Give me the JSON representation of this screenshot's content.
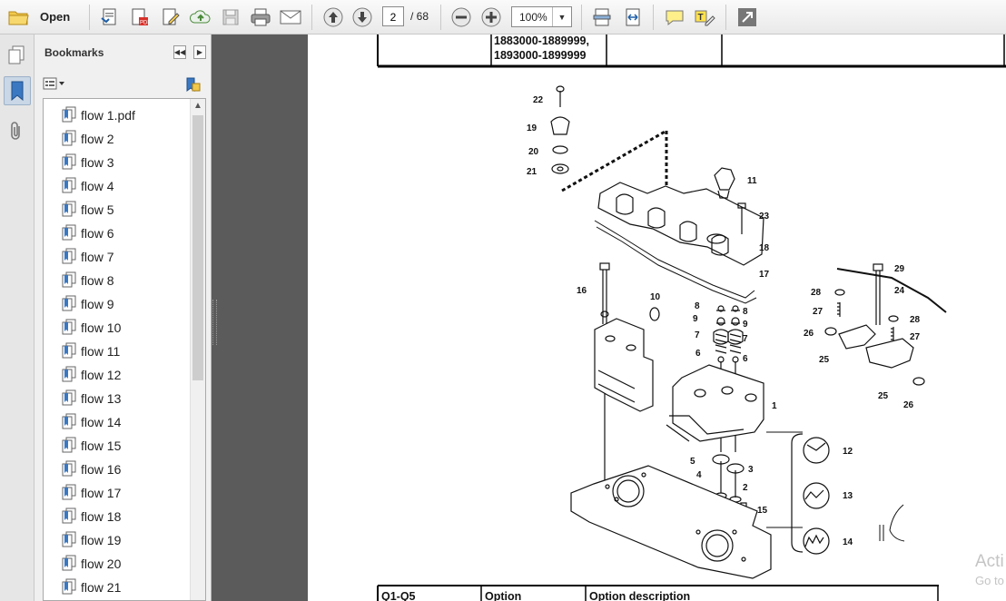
{
  "toolbar": {
    "open_label": "Open",
    "current_page": "2",
    "total_pages": "/ 68",
    "zoom_value": "100%"
  },
  "bookmarks": {
    "title": "Bookmarks",
    "items": [
      {
        "label": "flow 1.pdf"
      },
      {
        "label": "flow 2"
      },
      {
        "label": "flow 3"
      },
      {
        "label": "flow 4"
      },
      {
        "label": "flow 5"
      },
      {
        "label": "flow 6"
      },
      {
        "label": "flow 7"
      },
      {
        "label": "flow 8"
      },
      {
        "label": "flow 9"
      },
      {
        "label": "flow 10"
      },
      {
        "label": "flow 11"
      },
      {
        "label": "flow 12"
      },
      {
        "label": "flow 13"
      },
      {
        "label": "flow 14"
      },
      {
        "label": "flow 15"
      },
      {
        "label": "flow 16"
      },
      {
        "label": "flow 17"
      },
      {
        "label": "flow 18"
      },
      {
        "label": "flow 19"
      },
      {
        "label": "flow 20"
      },
      {
        "label": "flow 21"
      }
    ]
  },
  "document": {
    "table_top": {
      "serial_1": "1883000-1889999,",
      "serial_2": "1893000-1899999"
    },
    "diagram_labels": {
      "l1": "1",
      "l2": "2",
      "l3": "3",
      "l4": "4",
      "l5": "5",
      "l6a": "6",
      "l6b": "6",
      "l7a": "7",
      "l7b": "7",
      "l8a": "8",
      "l8b": "8",
      "l9a": "9",
      "l9b": "9",
      "l10": "10",
      "l11": "11",
      "l12": "12",
      "l13": "13",
      "l14": "14",
      "l15": "15",
      "l16": "16",
      "l17": "17",
      "l18": "18",
      "l19": "19",
      "l20": "20",
      "l21": "21",
      "l22": "22",
      "l23": "23",
      "l24": "24",
      "l25a": "25",
      "l25b": "25",
      "l26a": "26",
      "l26b": "26",
      "l27a": "27",
      "l27b": "27",
      "l28a": "28",
      "l28b": "28",
      "l29": "29"
    },
    "table_bottom": {
      "col1": "Q1-Q5",
      "col2": "Option",
      "col3": "Option description"
    }
  },
  "watermark": {
    "line1": "Acti",
    "line2": "Go to"
  },
  "colors": {
    "accent": "#1f5fa8",
    "panel_dark": "#5b5b5b"
  }
}
